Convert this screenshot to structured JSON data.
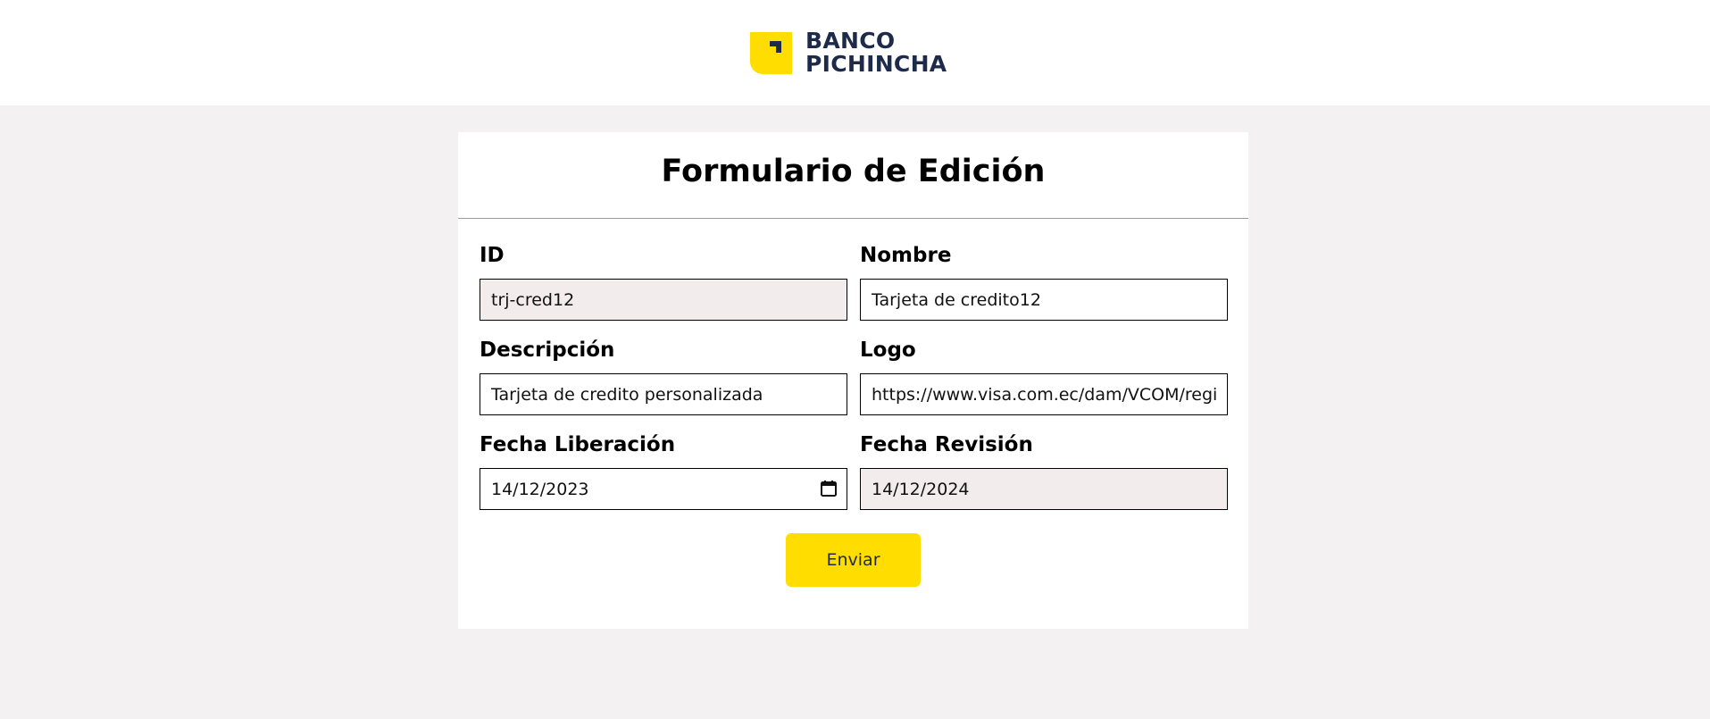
{
  "header": {
    "logo_line1": "BANCO",
    "logo_line2": "PICHINCHA",
    "brand_color": "#ffdd00",
    "brand_text_color": "#1d2a4a"
  },
  "form": {
    "title": "Formulario de Edición",
    "fields": {
      "id": {
        "label": "ID",
        "value": "trj-cred12",
        "readonly": true
      },
      "nombre": {
        "label": "Nombre",
        "value": "Tarjeta de credito12",
        "readonly": false
      },
      "descripcion": {
        "label": "Descripción",
        "value": "Tarjeta de credito personalizada",
        "readonly": false
      },
      "logo": {
        "label": "Logo",
        "value": "https://www.visa.com.ec/dam/VCOM/regiona",
        "readonly": false
      },
      "fecha_liberacion": {
        "label": "Fecha Liberación",
        "value": "14/12/2023",
        "icon": "calendar-icon",
        "readonly": false
      },
      "fecha_revision": {
        "label": "Fecha Revisión",
        "value": "14/12/2024",
        "readonly": true
      }
    },
    "submit_label": "Enviar"
  }
}
